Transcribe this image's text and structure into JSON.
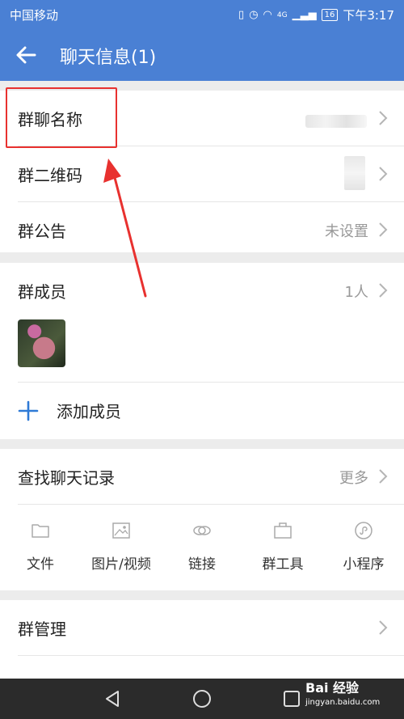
{
  "status_bar": {
    "carrier": "中国移动",
    "network": "4G",
    "battery": "16",
    "time": "下午3:17"
  },
  "header": {
    "title": "聊天信息(1)",
    "back_icon": "arrow-left-icon"
  },
  "section1": {
    "group_name_label": "群聊名称",
    "qr_code_label": "群二维码",
    "notice_label": "群公告",
    "notice_value": "未设置"
  },
  "members": {
    "label": "群成员",
    "count": "1人",
    "add_label": "添加成员"
  },
  "search": {
    "label": "查找聊天记录",
    "more": "更多",
    "tools": [
      {
        "label": "文件",
        "icon": "folder-icon"
      },
      {
        "label": "图片/视频",
        "icon": "image-icon"
      },
      {
        "label": "链接",
        "icon": "link-icon"
      },
      {
        "label": "群工具",
        "icon": "toolbox-icon"
      },
      {
        "label": "小程序",
        "icon": "mini-program-icon"
      }
    ]
  },
  "manage": {
    "label": "群管理"
  },
  "watermark": {
    "brand": "Bai 经验",
    "url": "jingyan.baidu.com"
  },
  "colors": {
    "header_bg": "#4a80d4",
    "accent": "#2e7ad6",
    "annotation": "#e8312f"
  }
}
